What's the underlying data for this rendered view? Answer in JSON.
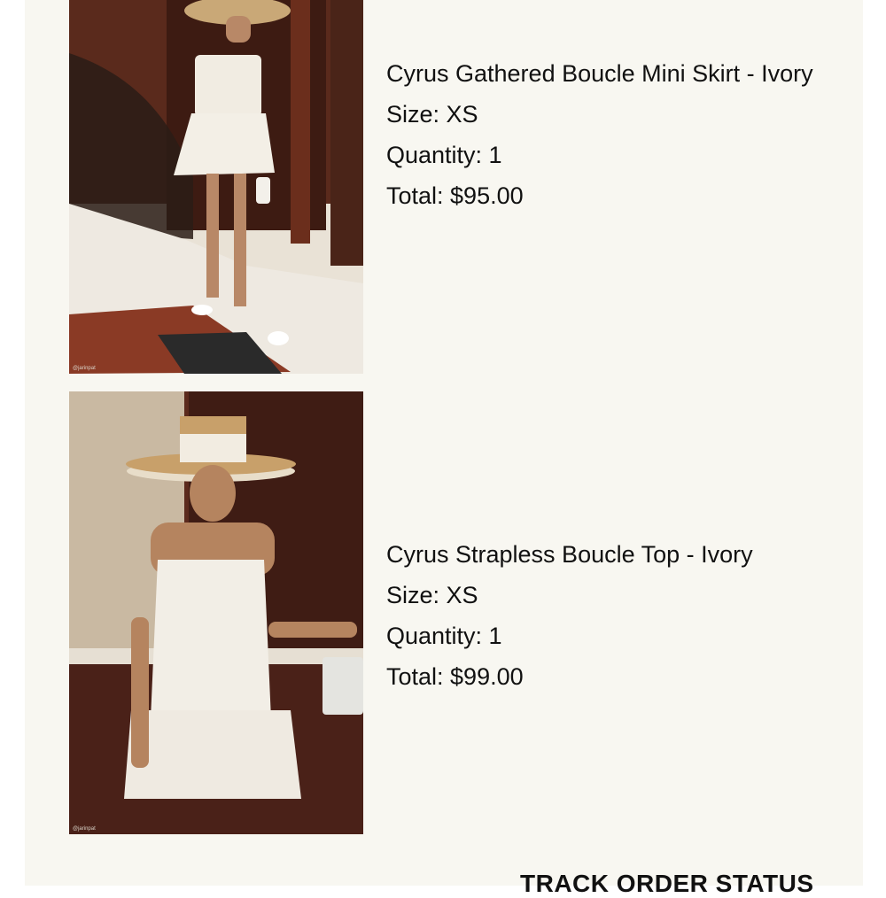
{
  "order_items": [
    {
      "name": "Cyrus Gathered Boucle Mini Skirt - Ivory",
      "size": "Size: XS",
      "quantity": "Quantity: 1",
      "total": "Total: $95.00",
      "photo_credit": "@jarinpat"
    },
    {
      "name": "Cyrus Strapless Boucle Top - Ivory",
      "size": "Size: XS",
      "quantity": "Quantity: 1",
      "total": "Total: $99.00",
      "photo_credit": "@jarinpat"
    }
  ],
  "actions": {
    "track_order_label": "TRACK ORDER STATUS"
  },
  "colors": {
    "panel_background": "#f8f7f1",
    "text": "#111111"
  }
}
